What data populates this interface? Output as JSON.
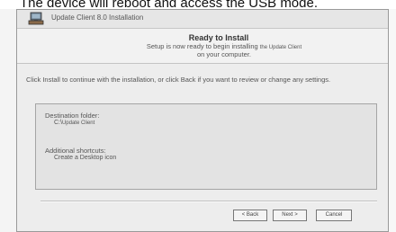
{
  "caption": {
    "text": "The device will reboot and access the USB mode."
  },
  "window": {
    "title": "Update Client 8.0 Installation",
    "icon": "installer-app-icon"
  },
  "header": {
    "title": "Ready to Install",
    "subtitle_start": "Setup is now ready to begin installing",
    "subtitle_product": "the Update Client",
    "subtitle_end": "on your computer."
  },
  "instruction": "Click Install to continue with the installation, or click Back if you want to review or change any settings.",
  "summary": {
    "destination_label": "Destination folder:",
    "destination_prefix": "C:\\",
    "destination_value": "Update Client",
    "shortcuts_label": "Additional shortcuts:",
    "shortcuts_value": "Create a Desktop icon"
  },
  "buttons": {
    "back": "< Back",
    "next": "Next >",
    "cancel": "Cancel"
  },
  "colors": {
    "window_bg": "#ededed",
    "summary_bg": "#e3e3e3"
  }
}
